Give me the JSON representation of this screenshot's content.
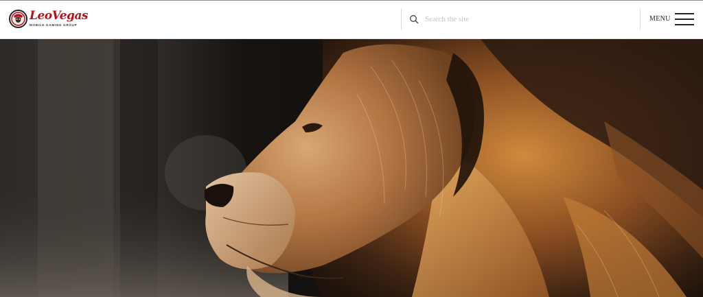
{
  "brand": {
    "name": "LeoVegas",
    "tagline": "MOBILE GAMING GROUP",
    "logo_color": "#b5121b"
  },
  "search": {
    "placeholder": "Search the site",
    "value": "",
    "icon": "search-icon"
  },
  "menu": {
    "label": "MENU",
    "icon": "hamburger-icon"
  },
  "hero": {
    "image": "lion-profile-photo"
  }
}
